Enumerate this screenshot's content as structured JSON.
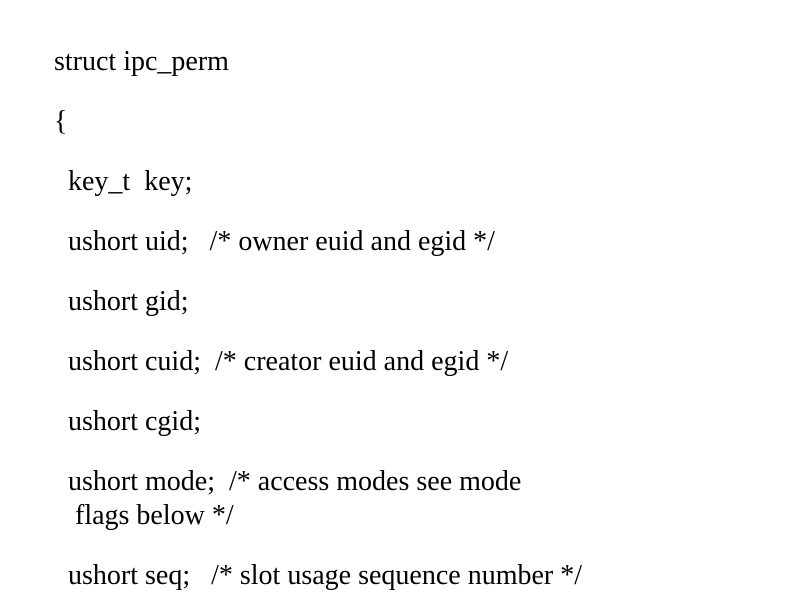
{
  "code": {
    "l1": "struct ipc_perm",
    "l2": "{",
    "l3": "  key_t  key;",
    "l4": "  ushort uid;   /* owner euid and egid */",
    "l5": "  ushort gid;",
    "l6": "  ushort cuid;  /* creator euid and egid */",
    "l7": "  ushort cgid;",
    "l8a": "  ushort mode;  /* access modes see mode",
    "l8b": "   flags below */",
    "l9": "  ushort seq;   /* slot usage sequence number */"
  }
}
